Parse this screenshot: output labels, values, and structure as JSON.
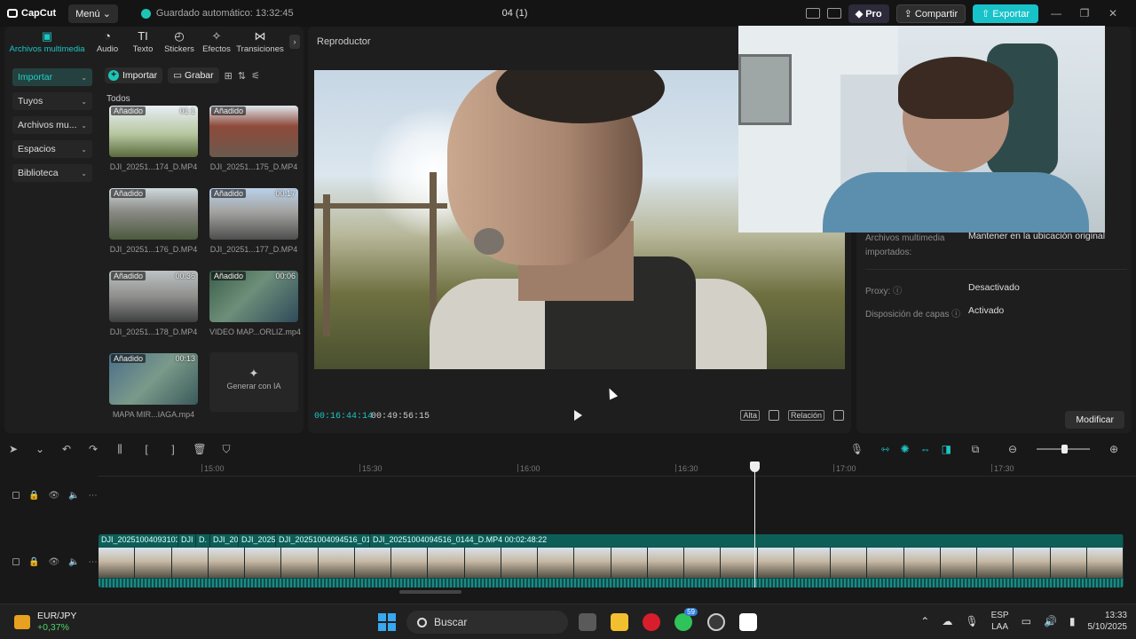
{
  "app": {
    "brand": "CapCut",
    "menu_label": "Menú",
    "autosave": "Guardado automático: 13:32:45",
    "project_title": "04 (1)",
    "pro_label": "Pro",
    "share_label": "Compartir",
    "export_label": "Exportar"
  },
  "categories": [
    {
      "label": "Archivos multimedia",
      "icon": "media-icon",
      "glyph": "▣",
      "active": true
    },
    {
      "label": "Audio",
      "icon": "audio-icon",
      "glyph": "◔"
    },
    {
      "label": "Texto",
      "icon": "text-icon",
      "glyph": "TI"
    },
    {
      "label": "Stickers",
      "icon": "sticker-icon",
      "glyph": "◴"
    },
    {
      "label": "Efectos",
      "icon": "effects-icon",
      "glyph": "✧"
    },
    {
      "label": "Transiciones",
      "icon": "transitions-icon",
      "glyph": "⋈"
    }
  ],
  "sidenav": [
    {
      "label": "Importar",
      "active": true
    },
    {
      "label": "Tuyos"
    },
    {
      "label": "Archivos mu..."
    },
    {
      "label": "Espacios"
    },
    {
      "label": "Biblioteca"
    }
  ],
  "media_toolbar": {
    "import_label": "Importar",
    "record_label": "Grabar",
    "filter_label": "Todos"
  },
  "media": [
    {
      "name": "DJI_20251...174_D.MP4",
      "added": "Añadido",
      "duration": "01:1"
    },
    {
      "name": "DJI_20251...175_D.MP4",
      "added": "Añadido",
      "duration": ""
    },
    {
      "name": "DJI_20251...176_D.MP4",
      "added": "Añadido",
      "duration": ""
    },
    {
      "name": "DJI_20251...177_D.MP4",
      "added": "Añadido",
      "duration": "00:17"
    },
    {
      "name": "DJI_20251...178_D.MP4",
      "added": "Añadido",
      "duration": "00:36"
    },
    {
      "name": "VIDEO MAP...ORLIZ.mp4",
      "added": "Añadido",
      "duration": "00:06"
    },
    {
      "name": "MAPA MIR...IAGA.mp4",
      "added": "Añadido",
      "duration": "00:13"
    }
  ],
  "generate_ai": "Generar con IA",
  "player": {
    "title": "Reproductor",
    "current_time": "00:16:44:14",
    "total_time": "00:49:56:15",
    "quality_label": "Alta",
    "ratio_label": "Relación"
  },
  "properties": {
    "rows": [
      {
        "label": "Archivos multimedia importados:",
        "value": "Mantener en la ubicación original"
      },
      {
        "label": "Proxy: ⓘ",
        "value": "Desactivado"
      },
      {
        "label": "Disposición de capas ⓘ",
        "value": "Activado"
      }
    ],
    "modify_label": "Modificar"
  },
  "timeline": {
    "ruler": [
      "15:00",
      "15:30",
      "16:00",
      "16:30",
      "17:00",
      "17:30"
    ],
    "clips": [
      "DJI_20251004093103_0",
      "DJI",
      "D.",
      "DJI_20",
      "DJI_2025",
      "DJI_20251004094516_014",
      "DJI_20251004094516_0144_D.MP4   00:02:48:22"
    ]
  },
  "taskbar": {
    "ticker_symbol": "EUR/JPY",
    "ticker_change": "+0,37%",
    "search_placeholder": "Buscar",
    "whatsapp_badge": "59",
    "lang_top": "ESP",
    "lang_bottom": "LAA",
    "time": "13:33",
    "date": "5/10/2025"
  }
}
